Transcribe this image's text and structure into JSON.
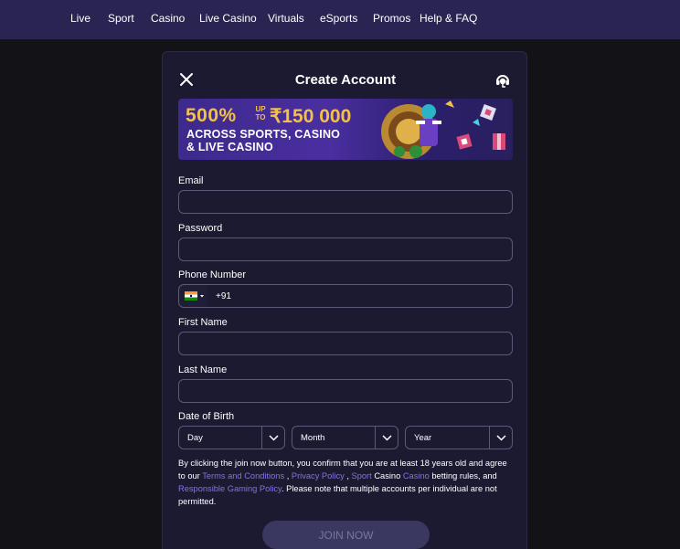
{
  "nav": {
    "items": [
      "Live",
      "Sport",
      "Casino",
      "Live Casino",
      "Virtuals",
      "eSports",
      "Promos",
      "Help & FAQ"
    ]
  },
  "modal": {
    "title": "Create Account"
  },
  "banner": {
    "amount_prefix": "500%",
    "up_to": "UP TO",
    "amount": "₹150 000",
    "line1": "ACROSS SPORTS, CASINO",
    "line2": "& LIVE CASINO"
  },
  "form": {
    "email_label": "Email",
    "password_label": "Password",
    "phone_label": "Phone Number",
    "phone_value": "+91",
    "first_name_label": "First Name",
    "last_name_label": "Last Name",
    "dob_label": "Date of Birth",
    "day_value": "Day",
    "month_value": "Month",
    "year_value": "Year"
  },
  "legal": {
    "part1": "By clicking the join now button, you confirm that you are at least 18 years old and agree to our ",
    "terms": "Terms and Conditions",
    "sep1": " , ",
    "privacy": "Privacy Policy",
    "sep2": " , ",
    "sport": "Sport",
    "casino_plain": " Casino ",
    "casino_link": "Casino",
    "part2": " betting rules, and ",
    "responsible": "Responsible Gaming Policy",
    "part3": ". Please note that multiple accounts per individual are not permitted."
  },
  "join_button": "JOIN NOW",
  "colors": {
    "nav_bg": "#2a2452",
    "page_bg": "#121217",
    "modal_bg": "#1b1a30",
    "link": "#7f74e6",
    "gold": "#f3c14a",
    "button_bg": "#3a3760"
  },
  "icons": [
    "close-icon",
    "support-icon",
    "india-flag-icon",
    "caret-down-icon",
    "chevron-down-icon"
  ]
}
